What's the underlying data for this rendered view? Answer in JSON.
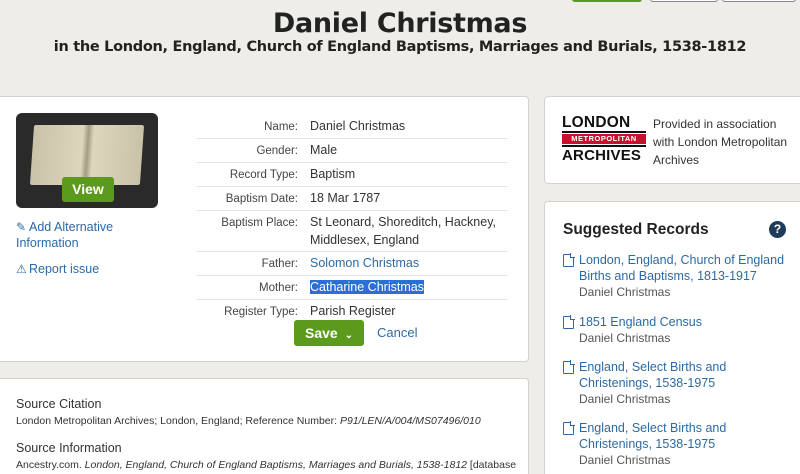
{
  "header": {
    "title": "Daniel Christmas",
    "subtitle": "in the London, England, Church of England Baptisms, Marriages and Burials, 1538-1812"
  },
  "record": {
    "view_label": "View",
    "add_alt_label": "Add Alternative Information",
    "report_label": "Report issue",
    "fields": [
      {
        "label": "Name:",
        "value": "Daniel Christmas"
      },
      {
        "label": "Gender:",
        "value": "Male"
      },
      {
        "label": "Record Type:",
        "value": "Baptism"
      },
      {
        "label": "Baptism Date:",
        "value": "18 Mar 1787"
      },
      {
        "label": "Baptism Place:",
        "value": "St Leonard, Shoreditch, Hackney, Middlesex, England"
      },
      {
        "label": "Father:",
        "value": "Solomon Christmas"
      },
      {
        "label": "Mother:",
        "value": "Catharine Christmas"
      },
      {
        "label": "Register Type:",
        "value": "Parish Register"
      }
    ],
    "save_label": "Save",
    "cancel_label": "Cancel"
  },
  "source": {
    "citation_heading": "Source Citation",
    "citation_text": "London Metropolitan Archives; London, England; Reference Number:",
    "citation_ref": "P91/LEN/A/004/MS07496/010",
    "info_heading": "Source Information",
    "info_prefix": "Ancestry.com.",
    "info_title": "London, England, Church of England Baptisms, Marriages and Burials, 1538-1812",
    "info_suffix": "[database"
  },
  "association": {
    "logo_line1": "LONDON",
    "logo_line2": "METROPOLITAN",
    "logo_line3": "ARCHIVES",
    "text": "Provided in association with London Metropolitan Archives"
  },
  "suggested": {
    "title": "Suggested Records",
    "help_glyph": "?",
    "items": [
      {
        "title": "London, England, Church of England Births and Baptisms, 1813-1917",
        "name": "Daniel Christmas"
      },
      {
        "title": "1851 England Census",
        "name": "Daniel Christmas"
      },
      {
        "title": "England, Select Births and Christenings, 1538-1975",
        "name": "Daniel Christmas"
      },
      {
        "title": "England, Select Births and Christenings, 1538-1975",
        "name": "Daniel Christmas"
      }
    ]
  },
  "colors": {
    "accent_green": "#5b9a1a",
    "link_blue": "#2c6aa6",
    "selection_blue": "#2a6fd6",
    "logo_red": "#c8102e"
  },
  "icons": [
    "pencil-icon",
    "warning-icon",
    "chevron-down-icon",
    "help-icon",
    "document-icon"
  ]
}
